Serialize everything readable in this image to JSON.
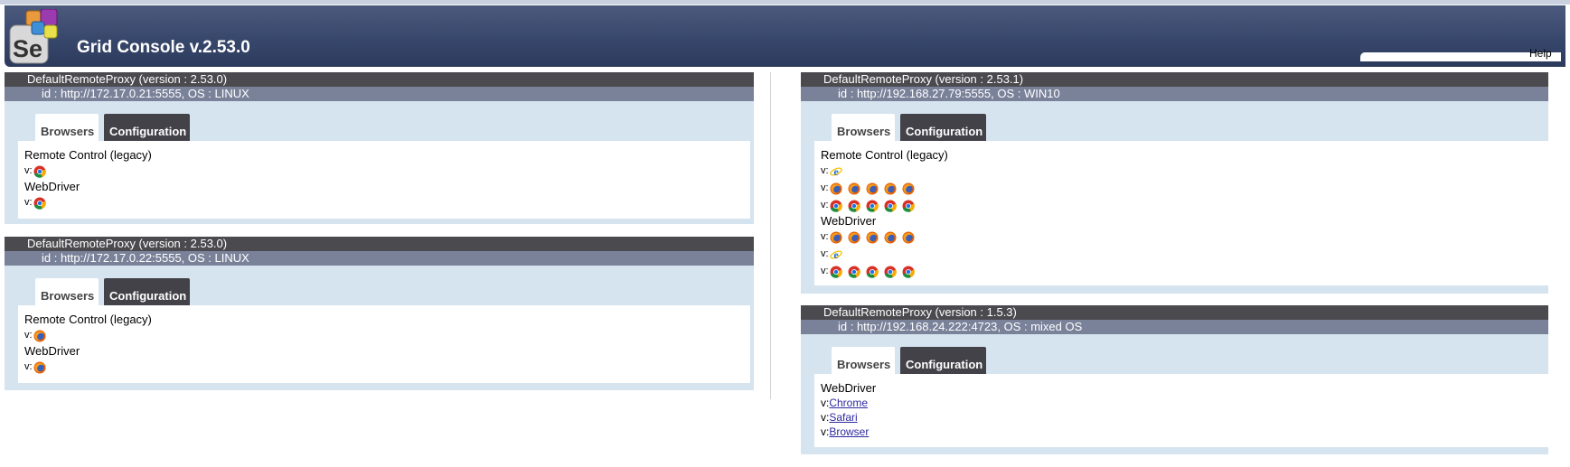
{
  "header": {
    "title": "Grid Console v.2.53.0",
    "help": "Help",
    "logo_text": "Se"
  },
  "tabs": {
    "browsers": "Browsers",
    "configuration": "Configuration"
  },
  "proxies": [
    {
      "title": "DefaultRemoteProxy (version : 2.53.0)",
      "id_line": "id : http://172.17.0.21:5555, OS : LINUX",
      "rc_label": "Remote Control (legacy)",
      "wd_label": "WebDriver",
      "v_label": "v:",
      "rc_icons": [
        "chrome-icon"
      ],
      "wd_icons": [
        "chrome-icon"
      ]
    },
    {
      "title": "DefaultRemoteProxy (version : 2.53.0)",
      "id_line": "id : http://172.17.0.22:5555, OS : LINUX",
      "rc_label": "Remote Control (legacy)",
      "wd_label": "WebDriver",
      "v_label": "v:",
      "rc_icons": [
        "firefox-icon"
      ],
      "wd_icons": [
        "firefox-icon"
      ]
    },
    {
      "title": "DefaultRemoteProxy (version : 2.53.1)",
      "id_line": "id : http://192.168.27.79:5555, OS : WIN10",
      "rc_label": "Remote Control (legacy)",
      "wd_label": "WebDriver",
      "v_label": "v:",
      "rc_rows": [
        [
          "ie-icon"
        ],
        [
          "firefox-icon",
          "firefox-icon",
          "firefox-icon",
          "firefox-icon",
          "firefox-icon"
        ],
        [
          "chrome-icon",
          "chrome-icon",
          "chrome-icon",
          "chrome-icon",
          "chrome-icon"
        ]
      ],
      "wd_rows": [
        [
          "firefox-icon",
          "firefox-icon",
          "firefox-icon",
          "firefox-icon",
          "firefox-icon"
        ],
        [
          "ie-icon"
        ],
        [
          "chrome-icon",
          "chrome-icon",
          "chrome-icon",
          "chrome-icon",
          "chrome-icon"
        ]
      ]
    },
    {
      "title": "DefaultRemoteProxy (version : 1.5.3)",
      "id_line": "id : http://192.168.24.222:4723, OS : mixed OS",
      "wd_label": "WebDriver",
      "v_label": "v:",
      "links": [
        "Chrome",
        "Safari",
        "Browser"
      ]
    }
  ],
  "colors": {
    "header_bg": "#3a4a6e",
    "proxy_title_bg": "#4b4b4f",
    "proxy_id_bg": "#7a829a",
    "proxy_body_bg": "#d6e4ef",
    "link": "#2e2aa0"
  }
}
